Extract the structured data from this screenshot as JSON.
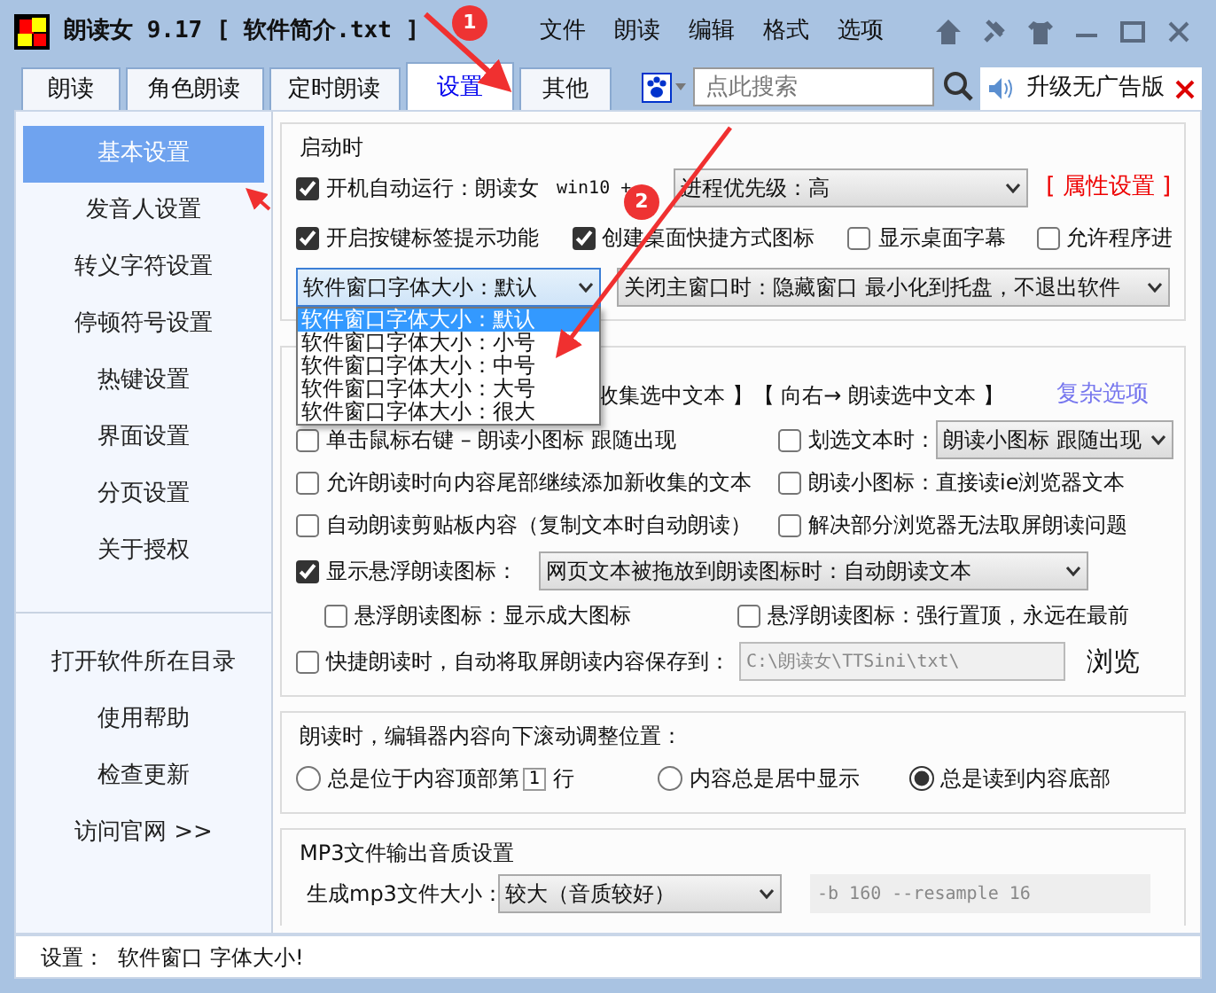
{
  "window": {
    "title": "朗读女 9.17 [ 软件简介.txt ]"
  },
  "menu": [
    "文件",
    "朗读",
    "编辑",
    "格式",
    "选项"
  ],
  "tabs": [
    {
      "label": "朗读",
      "selected": false
    },
    {
      "label": "角色朗读",
      "selected": false
    },
    {
      "label": "定时朗读",
      "selected": false
    },
    {
      "label": "设置",
      "selected": true
    },
    {
      "label": "其他",
      "selected": false
    }
  ],
  "search": {
    "placeholder": "点此搜索"
  },
  "upgrade": "升级无广告版",
  "sidebar": {
    "items": [
      {
        "label": "基本设置",
        "selected": true
      },
      {
        "label": "发音人设置",
        "selected": false
      },
      {
        "label": "转义字符设置",
        "selected": false
      },
      {
        "label": "停顿符号设置",
        "selected": false
      },
      {
        "label": "热键设置",
        "selected": false
      },
      {
        "label": "界面设置",
        "selected": false
      },
      {
        "label": "分页设置",
        "selected": false
      },
      {
        "label": "关于授权",
        "selected": false
      }
    ],
    "links": [
      "打开软件所在目录",
      "使用帮助",
      "检查更新",
      "访问官网 >>"
    ]
  },
  "startup": {
    "title": "启动时",
    "autorun": {
      "label": "开机自动运行：朗读女",
      "checked": true
    },
    "win10": "win10 +",
    "priority": "进程优先级：高",
    "props_link": "[ 属性设置 ]",
    "options": [
      {
        "label": "开启按键标签提示功能",
        "checked": true
      },
      {
        "label": "创建桌面快捷方式图标",
        "checked": true
      },
      {
        "label": "显示桌面字幕",
        "checked": false
      },
      {
        "label": "允许程序进",
        "checked": false
      }
    ],
    "font_select": {
      "value": "软件窗口字体大小：默认",
      "options": [
        {
          "label": "软件窗口字体大小：默认",
          "selected": true
        },
        {
          "label": "软件窗口字体大小：小号",
          "selected": false
        },
        {
          "label": "软件窗口字体大小：中号",
          "selected": false
        },
        {
          "label": "软件窗口字体大小：大号",
          "selected": false
        },
        {
          "label": "软件窗口字体大小：很大",
          "selected": false
        }
      ]
    },
    "close_select": "关闭主窗口时：隐藏窗口 最小化到托盘，不退出软件"
  },
  "reading": {
    "hotkey_text": "收集选中文本 】【 向右→ 朗读选中文本 】",
    "complex_link": "复杂选项",
    "rows": [
      [
        {
          "label": "单击鼠标右键 – 朗读小图标 跟随出现",
          "checked": false
        },
        {
          "label": "划选文本时：",
          "checked": false,
          "select": "朗读小图标 跟随出现"
        }
      ],
      [
        {
          "label": "允许朗读时向内容尾部继续添加新收集的文本",
          "checked": false
        },
        {
          "label": "朗读小图标：直接读ie浏览器文本",
          "checked": false
        }
      ],
      [
        {
          "label": "自动朗读剪贴板内容（复制文本时自动朗读）",
          "checked": false
        },
        {
          "label": "解决部分浏览器无法取屏朗读问题",
          "checked": false
        }
      ]
    ],
    "float_icon": {
      "label": "显示悬浮朗读图标：",
      "checked": true,
      "select": "网页文本被拖放到朗读图标时：自动朗读文本"
    },
    "float_options": [
      {
        "label": "悬浮朗读图标：显示成大图标",
        "checked": false
      },
      {
        "label": "悬浮朗读图标：强行置顶，永远在最前",
        "checked": false
      }
    ],
    "save": {
      "label": "快捷朗读时，自动将取屏朗读内容保存到：",
      "checked": false,
      "path": "C:\\朗读女\\TTSini\\txt\\",
      "browse": "浏览"
    }
  },
  "scroll": {
    "title": "朗读时，编辑器内容向下滚动调整位置：",
    "options": [
      {
        "kind": "line",
        "label": "总是位于内容顶部第",
        "value": "1",
        "unit": "行",
        "selected": false
      },
      {
        "kind": "plain",
        "label": "内容总是居中显示",
        "selected": false
      },
      {
        "kind": "plain",
        "label": "总是读到内容底部",
        "selected": true
      }
    ]
  },
  "mp3": {
    "title": "MP3文件输出音质设置",
    "size_label": "生成mp3文件大小：",
    "size_value": "较大（音质较好）",
    "params": "-b 160 --resample 16"
  },
  "status_bar": "设置：  软件窗口 字体大小!",
  "annotations": [
    {
      "label": "1"
    },
    {
      "label": "2"
    }
  ]
}
